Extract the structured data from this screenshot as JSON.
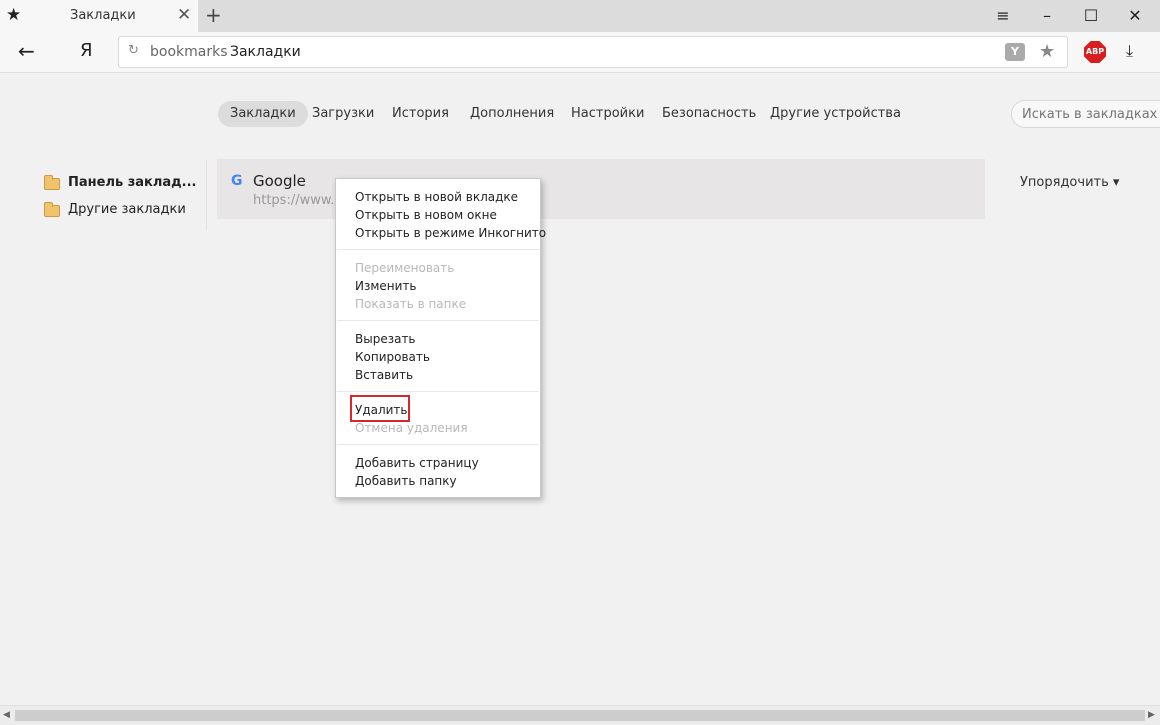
{
  "tab": {
    "title": "Закладки",
    "favicon": "star-icon"
  },
  "window": {
    "menu": "≡",
    "minimize": "–",
    "maximize": "☐",
    "close": "✕"
  },
  "address": {
    "host": "bookmarks",
    "title": "Закладки",
    "logo": "Я"
  },
  "toolbar": {
    "abp": "ABP"
  },
  "nav_tabs": [
    {
      "label": "Закладки",
      "active": true
    },
    {
      "label": "Загрузки"
    },
    {
      "label": "История"
    },
    {
      "label": "Дополнения"
    },
    {
      "label": "Настройки"
    },
    {
      "label": "Безопасность"
    },
    {
      "label": "Другие устройства"
    }
  ],
  "search": {
    "placeholder": "Искать в закладках"
  },
  "sidebar": {
    "items": [
      {
        "label": "Панель заклад..."
      },
      {
        "label": "Другие закладки"
      }
    ]
  },
  "bookmark": {
    "title": "Google",
    "url": "https://www.google.com/",
    "icon": "G"
  },
  "sort": {
    "label": "Упорядочить ▾"
  },
  "context_menu": {
    "items": [
      {
        "label": "Открыть в новой вкладке",
        "enabled": true
      },
      {
        "label": "Открыть в новом окне",
        "enabled": true
      },
      {
        "label": "Открыть в режиме Инкогнито",
        "enabled": true
      },
      {
        "label": "Переименовать",
        "enabled": false
      },
      {
        "label": "Изменить",
        "enabled": true
      },
      {
        "label": "Показать в папке",
        "enabled": false
      },
      {
        "label": "Вырезать",
        "enabled": true
      },
      {
        "label": "Копировать",
        "enabled": true
      },
      {
        "label": "Вставить",
        "enabled": true
      },
      {
        "label": "Удалить",
        "enabled": true,
        "highlighted": true
      },
      {
        "label": "Отмена удаления",
        "enabled": false
      },
      {
        "label": "Добавить страницу",
        "enabled": true
      },
      {
        "label": "Добавить папку",
        "enabled": true
      }
    ]
  },
  "colors": {
    "highlight": "#d9262b",
    "abp": "#d81e1e",
    "background": "#f2f1f1"
  }
}
